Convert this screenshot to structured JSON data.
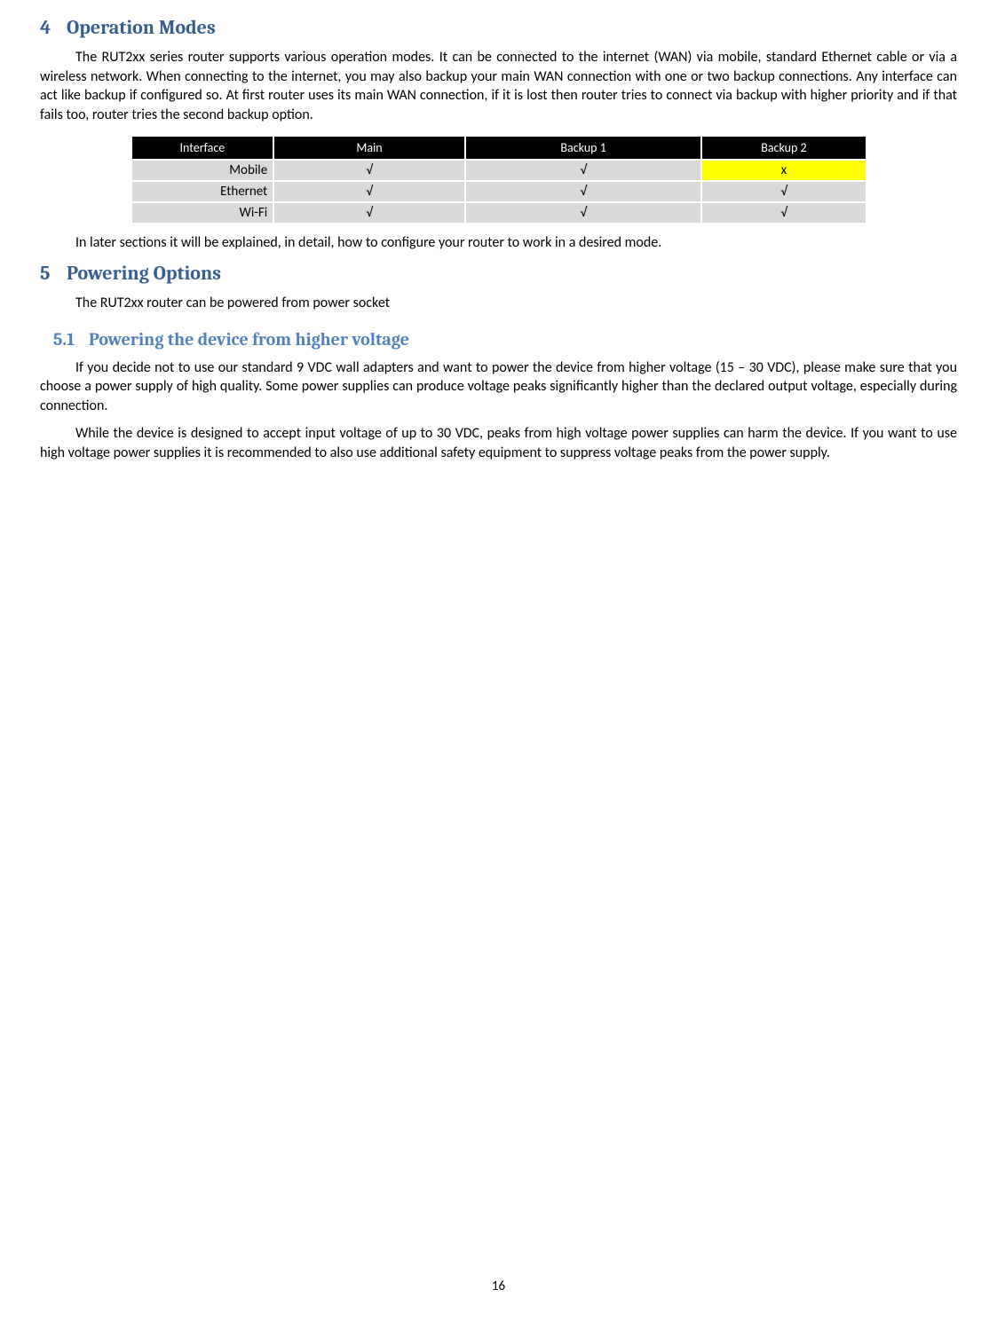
{
  "section4": {
    "num": "4",
    "title": "Operation Modes",
    "para1": "The RUT2xx series router supports various operation modes. It can be connected to the internet (WAN) via mobile, standard Ethernet cable or via a wireless network. When connecting to the internet, you may also backup your main WAN connection with one or two backup connections. Any interface can act like backup if configured so. At first router uses its main WAN connection, if it is lost then router tries to connect via backup with higher priority and if that fails too, router tries the second backup option.",
    "para2": "In later sections it will be explained, in detail, how to configure your router to work in a desired mode."
  },
  "table": {
    "headers": [
      "Interface",
      "Main",
      "Backup 1",
      "Backup 2"
    ],
    "rows": [
      {
        "iface": "Mobile",
        "main": "√",
        "b1": "√",
        "b2": "x",
        "b2_hl": true
      },
      {
        "iface": "Ethernet",
        "main": "√",
        "b1": "√",
        "b2": "√",
        "b2_hl": false
      },
      {
        "iface": "Wi-Fi",
        "main": "√",
        "b1": "√",
        "b2": "√",
        "b2_hl": false
      }
    ]
  },
  "section5": {
    "num": "5",
    "title": "Powering Options",
    "para1": "The RUT2xx router can be powered from power socket",
    "sub": {
      "num": "5.1",
      "title": "Powering the device from higher voltage",
      "para1": "If you decide not to use our standard 9 VDC wall adapters and want to power the device from higher voltage (15 – 30 VDC), please make sure that you choose a power supply of high quality. Some power supplies can produce voltage peaks significantly higher than the declared output voltage, especially during connection.",
      "para2": "While the device is designed to accept input voltage of up to 30 VDC, peaks from high voltage power supplies can harm the device. If you want to use high voltage power supplies it is recommended to also use additional safety equipment to suppress voltage peaks from the power supply."
    }
  },
  "page_number": "16"
}
